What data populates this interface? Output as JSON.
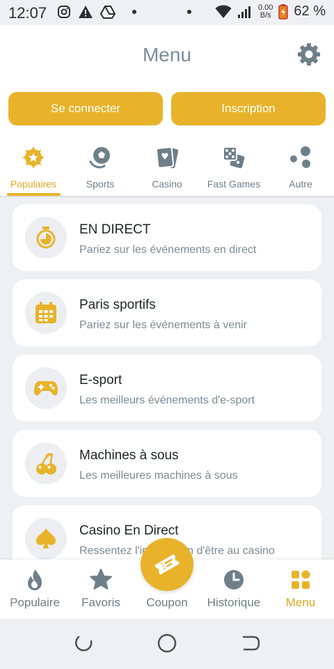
{
  "status_bar": {
    "time": "12:07",
    "speed_value": "0.00",
    "speed_unit": "B/s",
    "battery": "62 %",
    "icons": [
      "instagram-icon",
      "alert-icon",
      "drive-icon",
      "dot-icon",
      "dot-icon",
      "wifi-icon",
      "signal-icon",
      "battery-icon"
    ]
  },
  "header": {
    "title": "Menu",
    "settings_icon": "gear-icon"
  },
  "auth": {
    "login_label": "Se connecter",
    "signup_label": "Inscription"
  },
  "tabs": [
    {
      "label": "Populaires",
      "icon": "star-badge-icon",
      "active": true
    },
    {
      "label": "Sports",
      "icon": "sports-ball-icon",
      "active": false
    },
    {
      "label": "Casino",
      "icon": "cards-icon",
      "active": false
    },
    {
      "label": "Fast Games",
      "icon": "dice-icon",
      "active": false
    },
    {
      "label": "Autre",
      "icon": "circles-icon",
      "active": false
    }
  ],
  "items": [
    {
      "title": "EN DIRECT",
      "subtitle": "Pariez sur les événements en direct",
      "icon": "stopwatch-icon"
    },
    {
      "title": "Paris sportifs",
      "subtitle": "Pariez sur les événements à venir",
      "icon": "calendar-icon"
    },
    {
      "title": "E-sport",
      "subtitle": "Les meilleurs événements d'e-sport",
      "icon": "gamepad-icon"
    },
    {
      "title": "Machines à sous",
      "subtitle": "Les meilleures machines à sous",
      "icon": "cherries-icon"
    },
    {
      "title": "Casino En Direct",
      "subtitle": "Ressentez l'impression d'être au casino",
      "icon": "spade-icon"
    }
  ],
  "bottom_nav": [
    {
      "label": "Populaire",
      "icon": "flame-icon",
      "active": false
    },
    {
      "label": "Favoris",
      "icon": "star-icon",
      "active": false
    },
    {
      "label": "Coupon",
      "icon": "ticket-icon",
      "active": false
    },
    {
      "label": "Historique",
      "icon": "clock-icon",
      "active": false
    },
    {
      "label": "Menu",
      "icon": "grid-icon",
      "active": true
    }
  ],
  "colors": {
    "accent": "#e8b32a",
    "accent_text": "#e0a820",
    "muted": "#6f7f8a",
    "title": "#7a8c99",
    "card_bg": "#ffffff",
    "page_bg": "#eef0f3"
  }
}
